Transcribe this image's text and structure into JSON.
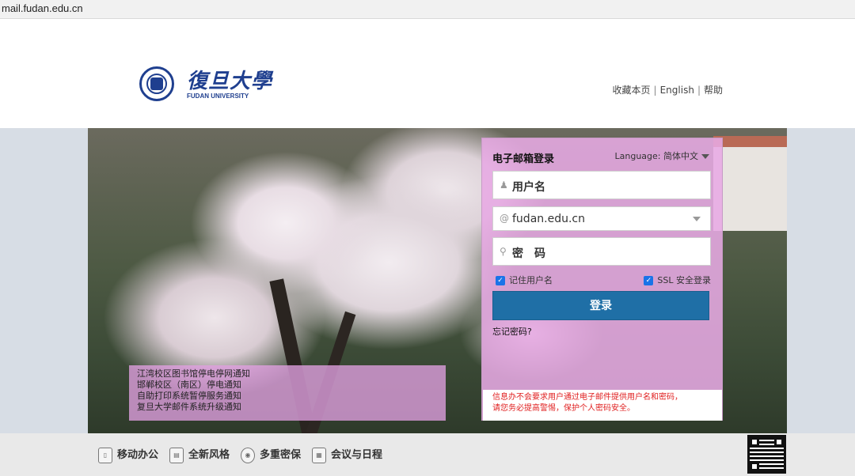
{
  "browser": {
    "url": "mail.fudan.edu.cn"
  },
  "header": {
    "logo_cn": "復旦大學",
    "logo_en": "FUDAN UNIVERSITY",
    "links": [
      "收藏本页",
      "English",
      "帮助"
    ]
  },
  "news": {
    "items": [
      "江湾校区图书馆停电停网通知",
      "邯郸校区（南区）停电通知",
      "自助打印系统暂停服务通知",
      "复旦大学邮件系统升级通知"
    ]
  },
  "login": {
    "title": "电子邮箱登录",
    "language_label": "Language:",
    "language_value": "简体中文",
    "username_placeholder": "用户名",
    "domain_value": "fudan.edu.cn",
    "password_placeholder": "密　码",
    "remember_label": "记住用户名",
    "ssl_label": "SSL 安全登录",
    "remember_checked": true,
    "ssl_checked": true,
    "login_button": "登录",
    "forgot": "忘记密码?",
    "notice": [
      "信息办不会要求用户通过电子邮件提供用户名和密码，",
      "请您务必提高警惕，保护个人密码安全。"
    ]
  },
  "footer": {
    "features": [
      {
        "label": "移动办公",
        "icon": "mobile-icon"
      },
      {
        "label": "全新风格",
        "icon": "style-icon"
      },
      {
        "label": "多重密保",
        "icon": "shield-icon"
      },
      {
        "label": "会议与日程",
        "icon": "calendar-icon"
      }
    ]
  }
}
